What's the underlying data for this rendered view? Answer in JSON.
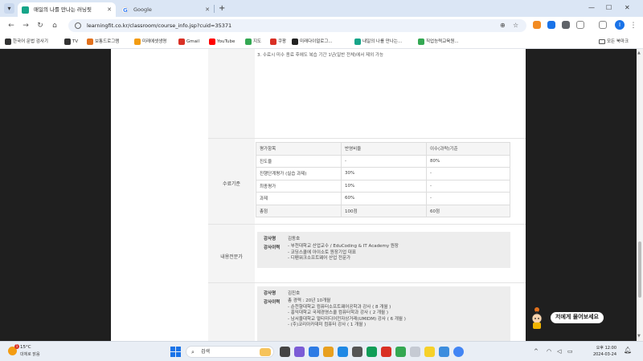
{
  "browser": {
    "tabs": [
      {
        "label": "매일의 나를 만나는 러닝핏",
        "active": true
      },
      {
        "label": "Google",
        "active": false
      }
    ],
    "new_tab": "+",
    "url": "learningfit.co.kr/classroom/course_info.jsp?cuid=35371"
  },
  "bookmarks": [
    {
      "label": "한국어 문법 검사기",
      "color": "#333333"
    },
    {
      "label": "TV",
      "color": "#333333"
    },
    {
      "label": "보통드로그램",
      "color": "#e2711d"
    },
    {
      "label": "미래에셋생명",
      "color": "#f39c12"
    },
    {
      "label": "Gmail",
      "color": "#d93025"
    },
    {
      "label": "YouTube",
      "color": "#ff0000"
    },
    {
      "label": "지도",
      "color": "#34a853"
    },
    {
      "label": "쿠팡",
      "color": "#d93025"
    },
    {
      "label": "미래다이얼로그...",
      "color": "#222222"
    },
    {
      "label": "내일의 나를 만나는...",
      "color": "#17a589"
    },
    {
      "label": "직업능력교육원...",
      "color": "#34a853"
    }
  ],
  "bookmarks_folder": "모든 북마크",
  "page": {
    "notice": "3. 수료시 미수 종료 후에도 복습 기간 1년(일반 전체)에서 제외 가능",
    "eval_label": "수료기준",
    "eval_table": {
      "headers": [
        "평가항목",
        "반영비율",
        "이수(과락)기준"
      ],
      "rows": [
        [
          "진도율",
          "-",
          "80%"
        ],
        [
          "진행단계평가 (실습 과제)",
          "30%",
          "-"
        ],
        [
          "최종평가",
          "10%",
          "-"
        ],
        [
          "과제",
          "60%",
          "-"
        ]
      ],
      "total": [
        "총점",
        "100점",
        "60점"
      ]
    },
    "instructor_label": "내용전문가",
    "instructors": [
      {
        "name_key": "강사명",
        "name": "김동호",
        "career_key": "강사이력",
        "career": [
          "- 부천대학교 산업교수 / EduCoding & IT Academy 원장",
          "- 코딩스쿨에 아이소토 원장기업 대표",
          "- 디펜워크소프트웨어 산업 전문가"
        ]
      },
      {
        "name_key": "강사명",
        "name": "김진호",
        "career_key": "강사이력",
        "career": [
          "총 경력 : 20년 10개월",
          "- 순천향대학교 컴퓨터소프트웨어공학과 강사 ( 8 개월 )",
          "- 홍익대학교 국제경영스쿨 컴퓨터학과 강사 ( 2 개월 )",
          "- 남서울대학교 멀티미디어전자상거래(UMIDM) 강사 ( 6 개월 )",
          "- (주)코리아카데미 컴퓨터 강사 ( 1 개월 )"
        ]
      }
    ]
  },
  "chat_badge": "저에게 물어보세요",
  "taskbar": {
    "weather_temp": "15°C",
    "weather_cond": "대체로 맑음",
    "search_placeholder": "검색",
    "clock_time": "오후 12:00",
    "clock_date": "2024-03-24"
  },
  "colors": {
    "page_dark": "#1f1f1f",
    "label_bg": "#f4f4f4",
    "tab_bar": "#dbe6f5"
  }
}
